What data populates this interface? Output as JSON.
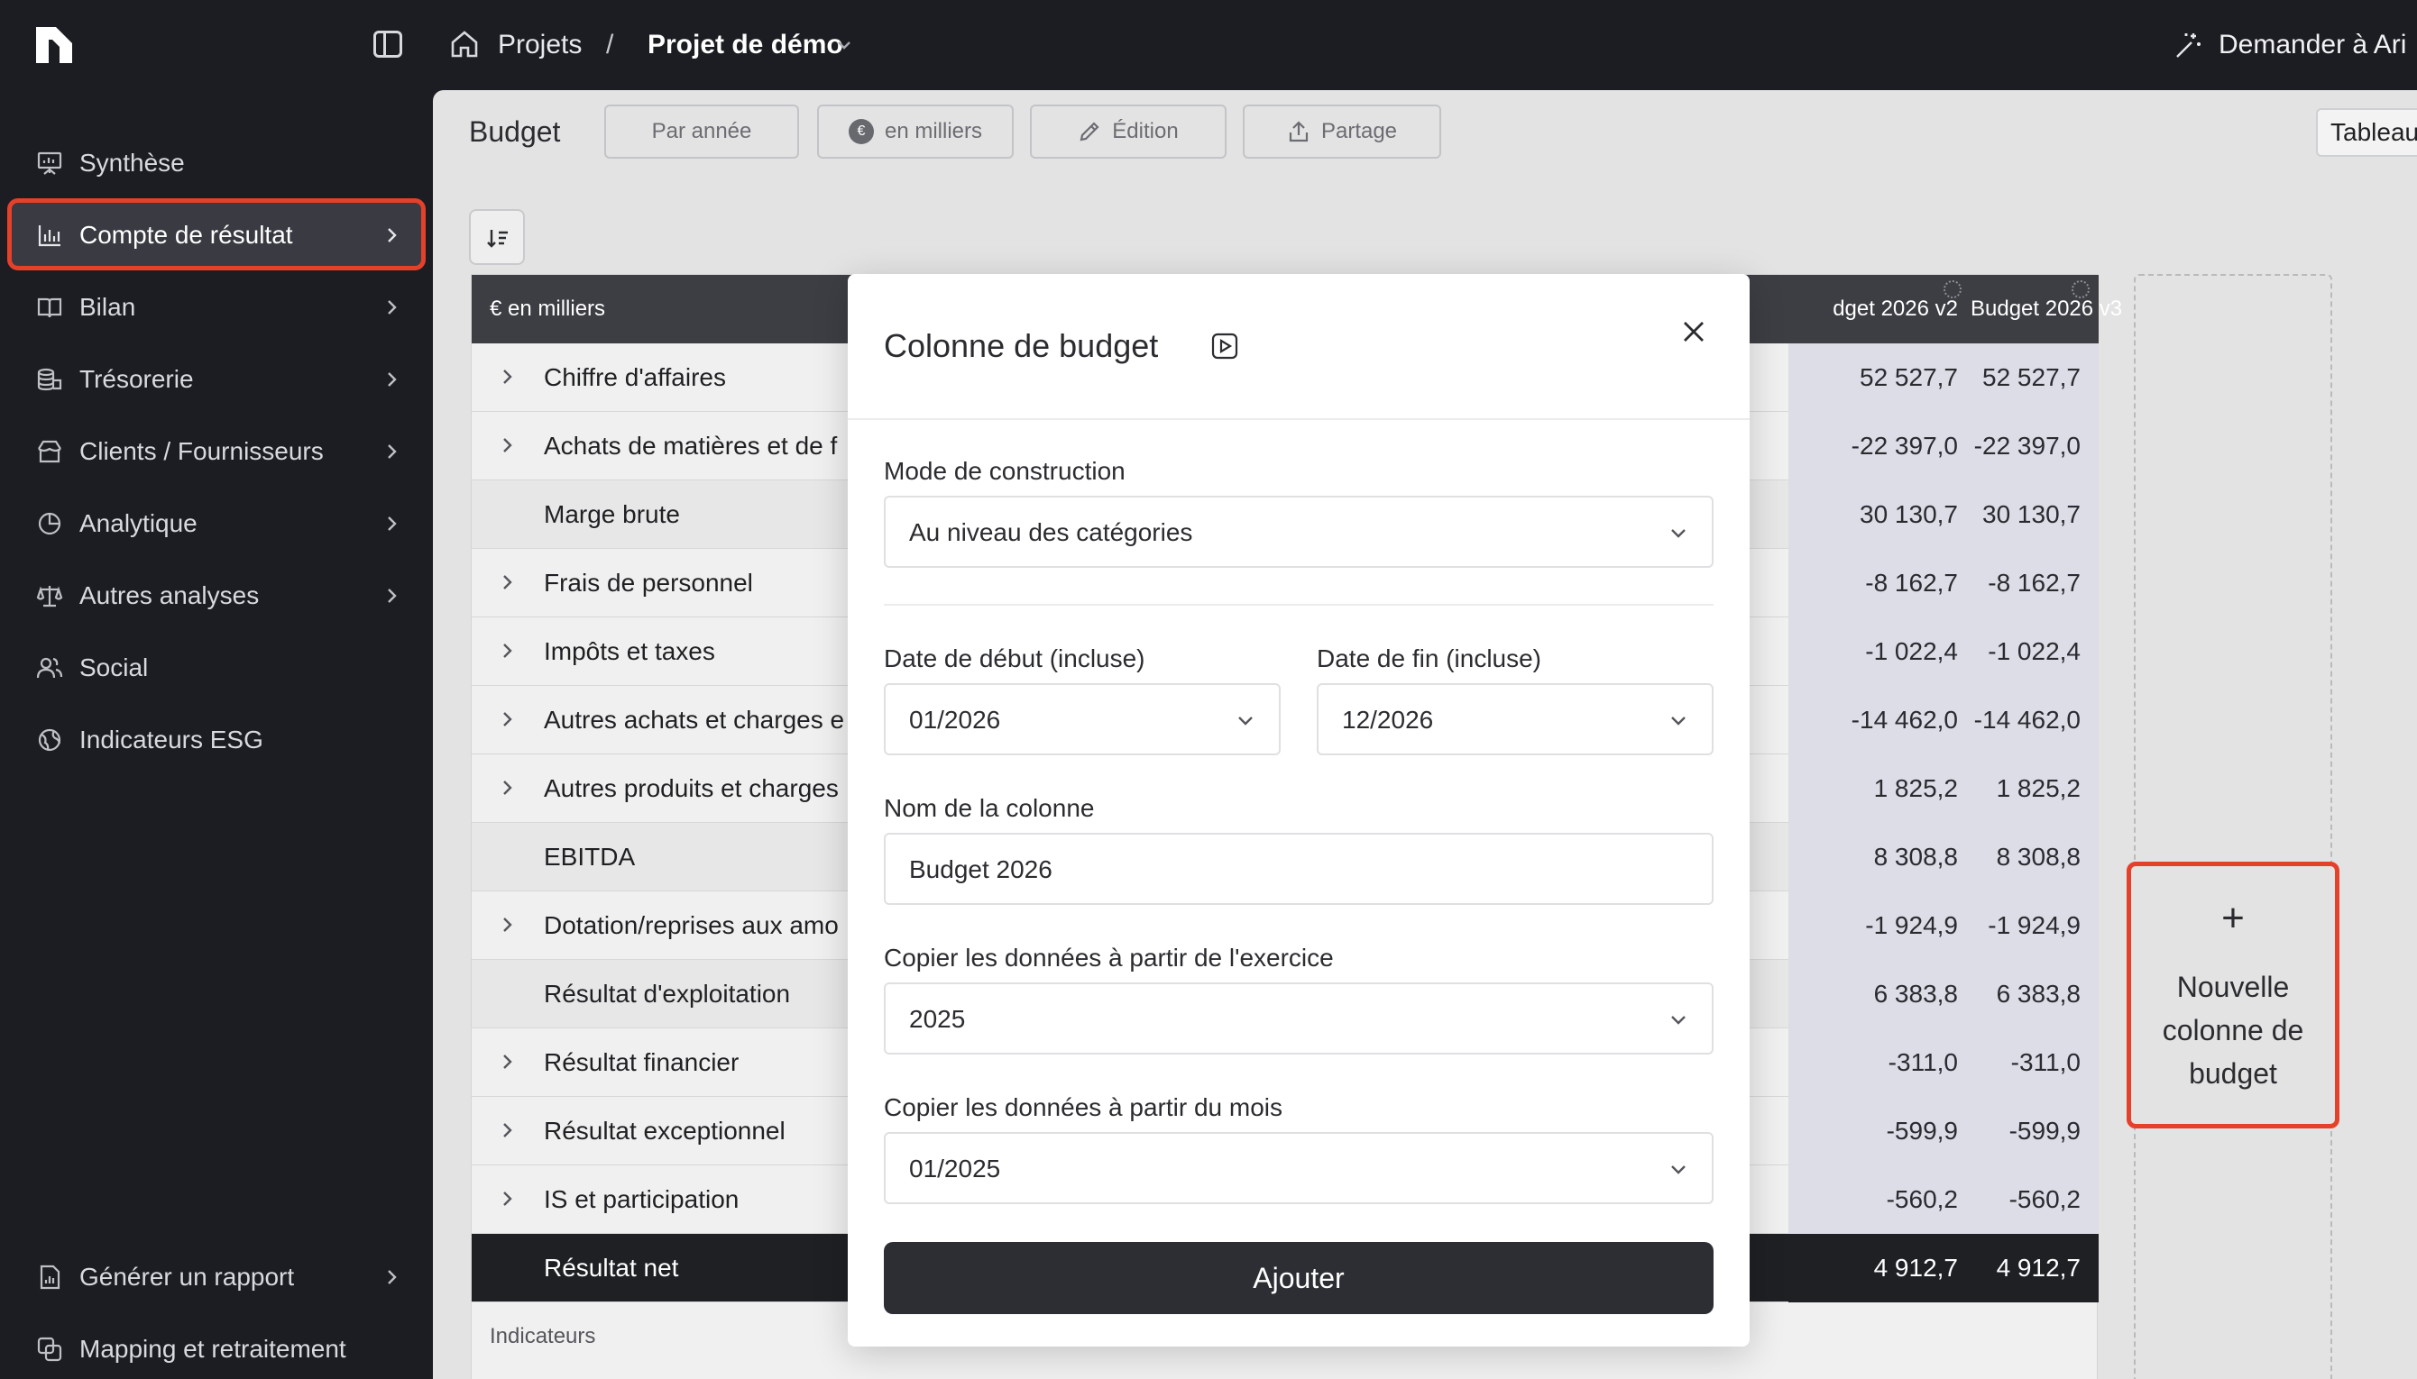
{
  "topbar": {
    "breadcrumb_projects": "Projets",
    "breadcrumb_separator": "/",
    "breadcrumb_current": "Projet de démo",
    "ask_label": "Demander à Ari"
  },
  "sidebar": {
    "items": [
      {
        "label": "Synthèse",
        "icon": "presentation-icon",
        "has_chevron": false
      },
      {
        "label": "Compte de résultat",
        "icon": "bar-chart-icon",
        "has_chevron": true,
        "active": true
      },
      {
        "label": "Bilan",
        "icon": "book-icon",
        "has_chevron": true
      },
      {
        "label": "Trésorerie",
        "icon": "coins-icon",
        "has_chevron": true
      },
      {
        "label": "Clients / Fournisseurs",
        "icon": "store-icon",
        "has_chevron": true
      },
      {
        "label": "Analytique",
        "icon": "pie-chart-icon",
        "has_chevron": true
      },
      {
        "label": "Autres analyses",
        "icon": "scale-icon",
        "has_chevron": true
      },
      {
        "label": "Social",
        "icon": "users-icon",
        "has_chevron": false
      },
      {
        "label": "Indicateurs ESG",
        "icon": "globe-icon",
        "has_chevron": false
      }
    ],
    "bottom_items": [
      {
        "label": "Générer un rapport",
        "icon": "report-icon",
        "has_chevron": true
      },
      {
        "label": "Mapping et retraitement",
        "icon": "mapping-icon",
        "has_chevron": false
      }
    ]
  },
  "main": {
    "title": "Budget",
    "toolbar": {
      "by_year": "Par année",
      "units_badge": "€",
      "units": "en milliers",
      "edit": "Édition",
      "share": "Partage",
      "view": "Tableau"
    }
  },
  "table": {
    "header_label": "€ en milliers",
    "columns": [
      "dget 2026 v2",
      "Budget 2026 v3"
    ],
    "rows": [
      {
        "label": "Chiffre d'affaires",
        "expandable": true,
        "subtotal": false,
        "v2": "52 527,7",
        "v3": "52 527,7"
      },
      {
        "label": "Achats de matières et de f",
        "expandable": true,
        "subtotal": false,
        "v2": "-22 397,0",
        "v3": "-22 397,0"
      },
      {
        "label": "Marge brute",
        "expandable": false,
        "subtotal": true,
        "v2": "30 130,7",
        "v3": "30 130,7"
      },
      {
        "label": "Frais de personnel",
        "expandable": true,
        "subtotal": false,
        "v2": "-8 162,7",
        "v3": "-8 162,7"
      },
      {
        "label": "Impôts et taxes",
        "expandable": true,
        "subtotal": false,
        "v2": "-1 022,4",
        "v3": "-1 022,4"
      },
      {
        "label": "Autres achats et charges e",
        "expandable": true,
        "subtotal": false,
        "v2": "-14 462,0",
        "v3": "-14 462,0"
      },
      {
        "label": "Autres produits et charges",
        "expandable": true,
        "subtotal": false,
        "v2": "1 825,2",
        "v3": "1 825,2"
      },
      {
        "label": "EBITDA",
        "expandable": false,
        "subtotal": true,
        "v2": "8 308,8",
        "v3": "8 308,8"
      },
      {
        "label": "Dotation/reprises aux amo",
        "expandable": true,
        "subtotal": false,
        "v2": "-1 924,9",
        "v3": "-1 924,9"
      },
      {
        "label": "Résultat d'exploitation",
        "expandable": false,
        "subtotal": true,
        "v2": "6 383,8",
        "v3": "6 383,8"
      },
      {
        "label": "Résultat financier",
        "expandable": true,
        "subtotal": false,
        "v2": "-311,0",
        "v3": "-311,0"
      },
      {
        "label": "Résultat exceptionnel",
        "expandable": true,
        "subtotal": false,
        "v2": "-599,9",
        "v3": "-599,9"
      },
      {
        "label": "IS et participation",
        "expandable": true,
        "subtotal": false,
        "v2": "-560,2",
        "v3": "-560,2"
      },
      {
        "label": "Résultat net",
        "expandable": false,
        "subtotal": true,
        "net": true,
        "v2": "4 912,7",
        "v3": "4 912,7"
      }
    ],
    "indicators_label": "Indicateurs"
  },
  "new_column": {
    "plus": "+",
    "label_line1": "Nouvelle",
    "label_line2": "colonne de",
    "label_line3": "budget"
  },
  "modal": {
    "title": "Colonne de budget",
    "mode_label": "Mode de construction",
    "mode_value": "Au niveau des catégories",
    "start_label": "Date de début (incluse)",
    "start_value": "01/2026",
    "end_label": "Date de fin (incluse)",
    "end_value": "12/2026",
    "name_label": "Nom de la colonne",
    "name_value": "Budget 2026",
    "copy_year_label": "Copier les données à partir de l'exercice",
    "copy_year_value": "2025",
    "copy_month_label": "Copier les données à partir du mois",
    "copy_month_value": "01/2025",
    "submit": "Ajouter"
  },
  "colors": {
    "dark_bg": "#1c1d22",
    "highlight": "#e5402a",
    "budget_cell": "#dcdde6",
    "submit_bg": "#2d2e33"
  }
}
